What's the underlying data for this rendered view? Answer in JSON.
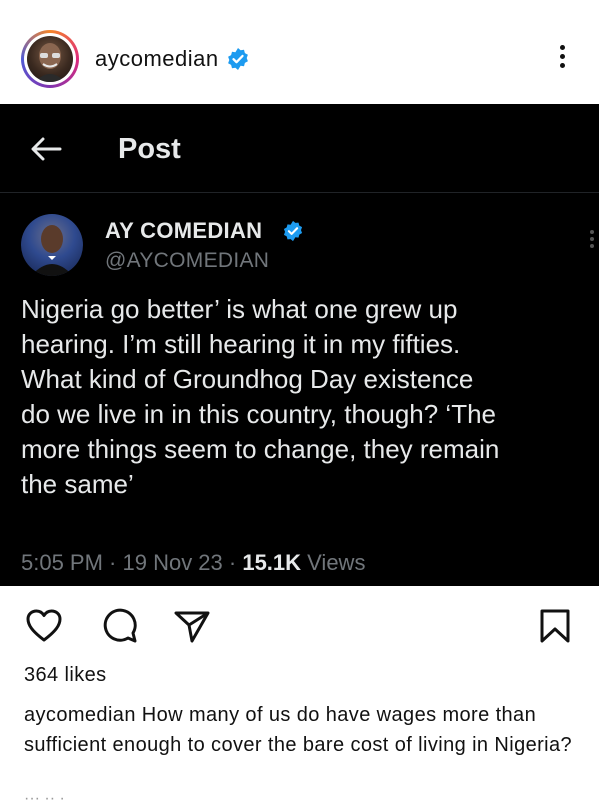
{
  "ig_post": {
    "username": "aycomedian",
    "verified_icon": "verified-badge-icon",
    "more_icon": "more-vertical-icon"
  },
  "tweet": {
    "topbar_title": "Post",
    "back_icon": "arrow-left-icon",
    "author_name": "AY COMEDIAN",
    "author_handle": "@AYCOMEDIAN",
    "text": "Nigeria go better’ is what one grew up\nhearing. I’m still hearing it in my fifties.\nWhat kind of Groundhog Day existence\ndo we live in in this country, though? ‘The\nmore things seem to change, they remain\nthe same’",
    "time": "5:05 PM · 19 Nov 23 · ",
    "views_count": "15.1K",
    "views_label": " Views"
  },
  "actions": {
    "like_icon": "heart-icon",
    "comment_icon": "comment-icon",
    "share_icon": "send-icon",
    "save_icon": "bookmark-icon"
  },
  "likes": "364 likes",
  "caption": {
    "username": "aycomedian",
    "text": " How many of us do have wages more than sufficient enough to cover the bare cost of living in Nigeria?"
  },
  "colors": {
    "verified_blue": "#1d9bf0",
    "tweet_bg": "#000000",
    "muted_gray": "#71767b"
  }
}
